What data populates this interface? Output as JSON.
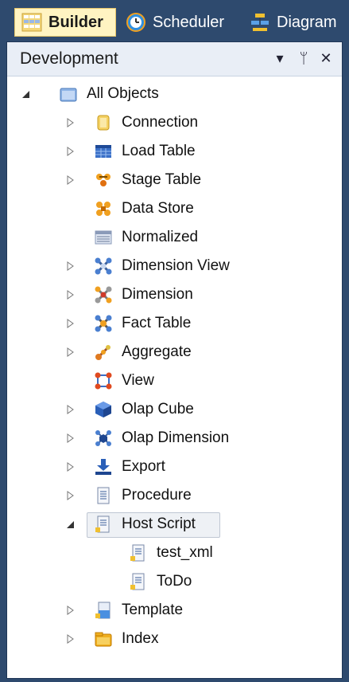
{
  "tabs": [
    {
      "label": "Builder",
      "icon": "grid-icon"
    },
    {
      "label": "Scheduler",
      "icon": "clock-icon"
    },
    {
      "label": "Diagram",
      "icon": "diagram-icon"
    }
  ],
  "panel": {
    "title": "Development",
    "buttons": {
      "dropdown": "▾",
      "pin": "ᛘ",
      "close": "✕"
    }
  },
  "tree": {
    "root": {
      "label": "All Objects",
      "icon": "folder-icon"
    },
    "items": [
      {
        "label": "Connection",
        "icon": "connection-icon"
      },
      {
        "label": "Load Table",
        "icon": "load-table-icon"
      },
      {
        "label": "Stage Table",
        "icon": "stage-table-icon"
      },
      {
        "label": "Data Store",
        "icon": "data-store-icon"
      },
      {
        "label": "Normalized",
        "icon": "normalized-icon"
      },
      {
        "label": "Dimension View",
        "icon": "dimension-view-icon"
      },
      {
        "label": "Dimension",
        "icon": "dimension-icon"
      },
      {
        "label": "Fact Table",
        "icon": "fact-table-icon"
      },
      {
        "label": "Aggregate",
        "icon": "aggregate-icon"
      },
      {
        "label": "View",
        "icon": "view-icon"
      },
      {
        "label": "Olap Cube",
        "icon": "olap-cube-icon"
      },
      {
        "label": "Olap Dimension",
        "icon": "olap-dimension-icon"
      },
      {
        "label": "Export",
        "icon": "export-icon"
      },
      {
        "label": "Procedure",
        "icon": "procedure-icon"
      },
      {
        "label": "Host Script",
        "icon": "host-script-icon"
      },
      {
        "label": "test_xml",
        "icon": "script-file-icon"
      },
      {
        "label": "ToDo",
        "icon": "script-file-icon"
      },
      {
        "label": "Template",
        "icon": "template-icon"
      },
      {
        "label": "Index",
        "icon": "index-icon"
      }
    ]
  }
}
